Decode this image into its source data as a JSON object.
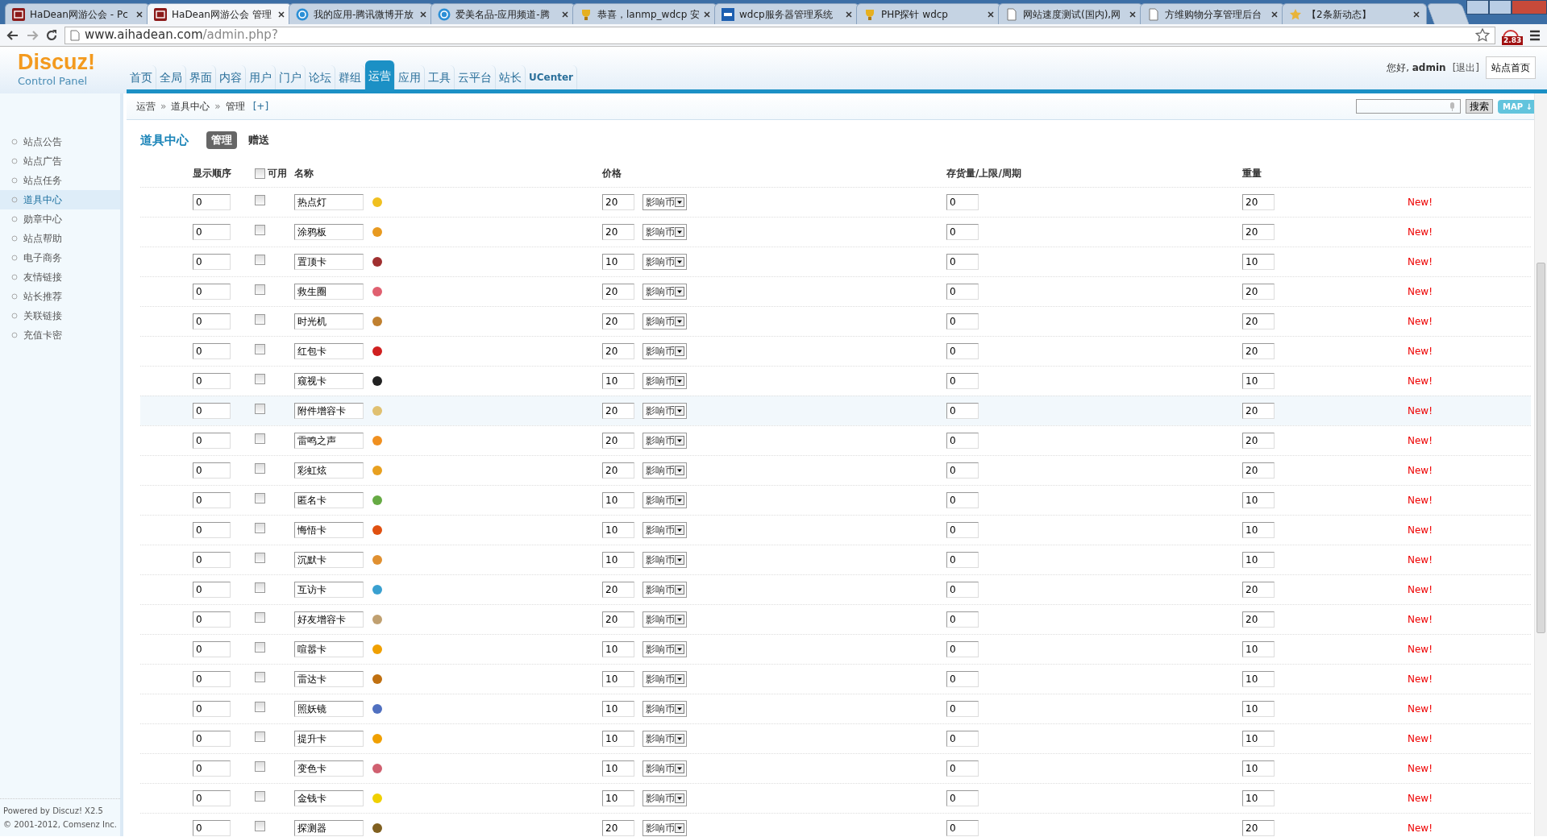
{
  "browser": {
    "tabs": [
      {
        "title": "HaDean网游公会 - Pc",
        "selected": false
      },
      {
        "title": "HaDean网游公会 管理",
        "selected": true
      },
      {
        "title": "我的应用-腾讯微博开放",
        "selected": false
      },
      {
        "title": "爱美名品-应用频道-腾",
        "selected": false
      },
      {
        "title": "恭喜，lanmp_wdcp 安",
        "selected": false
      },
      {
        "title": "wdcp服务器管理系统",
        "selected": false
      },
      {
        "title": "PHP探针 wdcp",
        "selected": false
      },
      {
        "title": "网站速度测试(国内),网",
        "selected": false
      },
      {
        "title": "方维购物分享管理后台",
        "selected": false
      },
      {
        "title": "【2条新动态】",
        "selected": false
      }
    ],
    "url_host": "www.aihadean.com",
    "url_path": "/admin.php?",
    "extension_badge": "2.83"
  },
  "header": {
    "logo": "Discuz!",
    "logo_sub": "Control Panel",
    "nav": [
      {
        "label": "首页",
        "selected": false
      },
      {
        "label": "全局",
        "selected": false
      },
      {
        "label": "界面",
        "selected": false
      },
      {
        "label": "内容",
        "selected": false
      },
      {
        "label": "用户",
        "selected": false
      },
      {
        "label": "门户",
        "selected": false
      },
      {
        "label": "论坛",
        "selected": false
      },
      {
        "label": "群组",
        "selected": false
      },
      {
        "label": "运营",
        "selected": true
      },
      {
        "label": "应用",
        "selected": false
      },
      {
        "label": "工具",
        "selected": false
      },
      {
        "label": "云平台",
        "selected": false
      },
      {
        "label": "站长",
        "selected": false
      },
      {
        "label": "UCenter",
        "selected": false
      }
    ],
    "greeting": "您好, **admin**",
    "logout": "[退出]",
    "site_home": "站点首页"
  },
  "breadcrumb": {
    "items": [
      "运营",
      "道具中心",
      "管理"
    ],
    "separators": [
      "»",
      "»"
    ],
    "add": "[+]",
    "search_button": "搜索",
    "map_button": "MAP ↓"
  },
  "sidebar": {
    "items": [
      {
        "label": "站点公告",
        "selected": false
      },
      {
        "label": "站点广告",
        "selected": false
      },
      {
        "label": "站点任务",
        "selected": false
      },
      {
        "label": "道具中心",
        "selected": true
      },
      {
        "label": "勋章中心",
        "selected": false
      },
      {
        "label": "站点帮助",
        "selected": false
      },
      {
        "label": "电子商务",
        "selected": false
      },
      {
        "label": "友情链接",
        "selected": false
      },
      {
        "label": "站长推荐",
        "selected": false
      },
      {
        "label": "关联链接",
        "selected": false
      },
      {
        "label": "充值卡密",
        "selected": false
      }
    ],
    "footer_line1": "Powered by",
    "footer_link1": "Discuz!",
    "footer_version": "X2.5",
    "footer_line2": "© 2001-2012,",
    "footer_link2": "Comsenz Inc."
  },
  "content": {
    "title": "道具中心",
    "subtabs": [
      {
        "label": "管理",
        "selected": true
      },
      {
        "label": "赠送",
        "selected": false
      }
    ],
    "columns": {
      "order": "显示顺序",
      "enabled": "可用",
      "enabled_all_checked": false,
      "name": "名称",
      "price": "价格",
      "stock": "存货量/上限/周期",
      "weight": "重量"
    },
    "rows": [
      {
        "order": "0",
        "checked": false,
        "name": "热点灯",
        "price": "20",
        "currency": "影响币",
        "stock": "0",
        "weight": "20",
        "status": "New!",
        "hovered": false
      },
      {
        "order": "0",
        "checked": false,
        "name": "涂鸦板",
        "price": "20",
        "currency": "影响币",
        "stock": "0",
        "weight": "20",
        "status": "New!",
        "hovered": false
      },
      {
        "order": "0",
        "checked": false,
        "name": "置顶卡",
        "price": "10",
        "currency": "影响币",
        "stock": "0",
        "weight": "10",
        "status": "New!",
        "hovered": false
      },
      {
        "order": "0",
        "checked": false,
        "name": "救生圈",
        "price": "20",
        "currency": "影响币",
        "stock": "0",
        "weight": "20",
        "status": "New!",
        "hovered": false
      },
      {
        "order": "0",
        "checked": false,
        "name": "时光机",
        "price": "20",
        "currency": "影响币",
        "stock": "0",
        "weight": "20",
        "status": "New!",
        "hovered": false
      },
      {
        "order": "0",
        "checked": false,
        "name": "红包卡",
        "price": "20",
        "currency": "影响币",
        "stock": "0",
        "weight": "20",
        "status": "New!",
        "hovered": false
      },
      {
        "order": "0",
        "checked": false,
        "name": "窥视卡",
        "price": "10",
        "currency": "影响币",
        "stock": "0",
        "weight": "10",
        "status": "New!",
        "hovered": false
      },
      {
        "order": "0",
        "checked": false,
        "name": "附件增容卡",
        "price": "20",
        "currency": "影响币",
        "stock": "0",
        "weight": "20",
        "status": "New!",
        "hovered": true
      },
      {
        "order": "0",
        "checked": false,
        "name": "雷鸣之声",
        "price": "20",
        "currency": "影响币",
        "stock": "0",
        "weight": "20",
        "status": "New!",
        "hovered": false
      },
      {
        "order": "0",
        "checked": false,
        "name": "彩虹炫",
        "price": "20",
        "currency": "影响币",
        "stock": "0",
        "weight": "20",
        "status": "New!",
        "hovered": false
      },
      {
        "order": "0",
        "checked": false,
        "name": "匿名卡",
        "price": "10",
        "currency": "影响币",
        "stock": "0",
        "weight": "10",
        "status": "New!",
        "hovered": false
      },
      {
        "order": "0",
        "checked": false,
        "name": "悔悟卡",
        "price": "10",
        "currency": "影响币",
        "stock": "0",
        "weight": "10",
        "status": "New!",
        "hovered": false
      },
      {
        "order": "0",
        "checked": false,
        "name": "沉默卡",
        "price": "10",
        "currency": "影响币",
        "stock": "0",
        "weight": "10",
        "status": "New!",
        "hovered": false
      },
      {
        "order": "0",
        "checked": false,
        "name": "互访卡",
        "price": "20",
        "currency": "影响币",
        "stock": "0",
        "weight": "20",
        "status": "New!",
        "hovered": false
      },
      {
        "order": "0",
        "checked": false,
        "name": "好友增容卡",
        "price": "20",
        "currency": "影响币",
        "stock": "0",
        "weight": "20",
        "status": "New!",
        "hovered": false
      },
      {
        "order": "0",
        "checked": false,
        "name": "喧嚣卡",
        "price": "10",
        "currency": "影响币",
        "stock": "0",
        "weight": "10",
        "status": "New!",
        "hovered": false
      },
      {
        "order": "0",
        "checked": false,
        "name": "雷达卡",
        "price": "10",
        "currency": "影响币",
        "stock": "0",
        "weight": "10",
        "status": "New!",
        "hovered": false
      },
      {
        "order": "0",
        "checked": false,
        "name": "照妖镜",
        "price": "10",
        "currency": "影响币",
        "stock": "0",
        "weight": "10",
        "status": "New!",
        "hovered": false
      },
      {
        "order": "0",
        "checked": false,
        "name": "提升卡",
        "price": "10",
        "currency": "影响币",
        "stock": "0",
        "weight": "10",
        "status": "New!",
        "hovered": false
      },
      {
        "order": "0",
        "checked": false,
        "name": "变色卡",
        "price": "10",
        "currency": "影响币",
        "stock": "0",
        "weight": "10",
        "status": "New!",
        "hovered": false
      },
      {
        "order": "0",
        "checked": false,
        "name": "金钱卡",
        "price": "10",
        "currency": "影响币",
        "stock": "0",
        "weight": "10",
        "status": "New!",
        "hovered": false
      },
      {
        "order": "0",
        "checked": false,
        "name": "探测器",
        "price": "20",
        "currency": "影响币",
        "stock": "0",
        "weight": "20",
        "status": "New!",
        "hovered": false
      }
    ]
  }
}
